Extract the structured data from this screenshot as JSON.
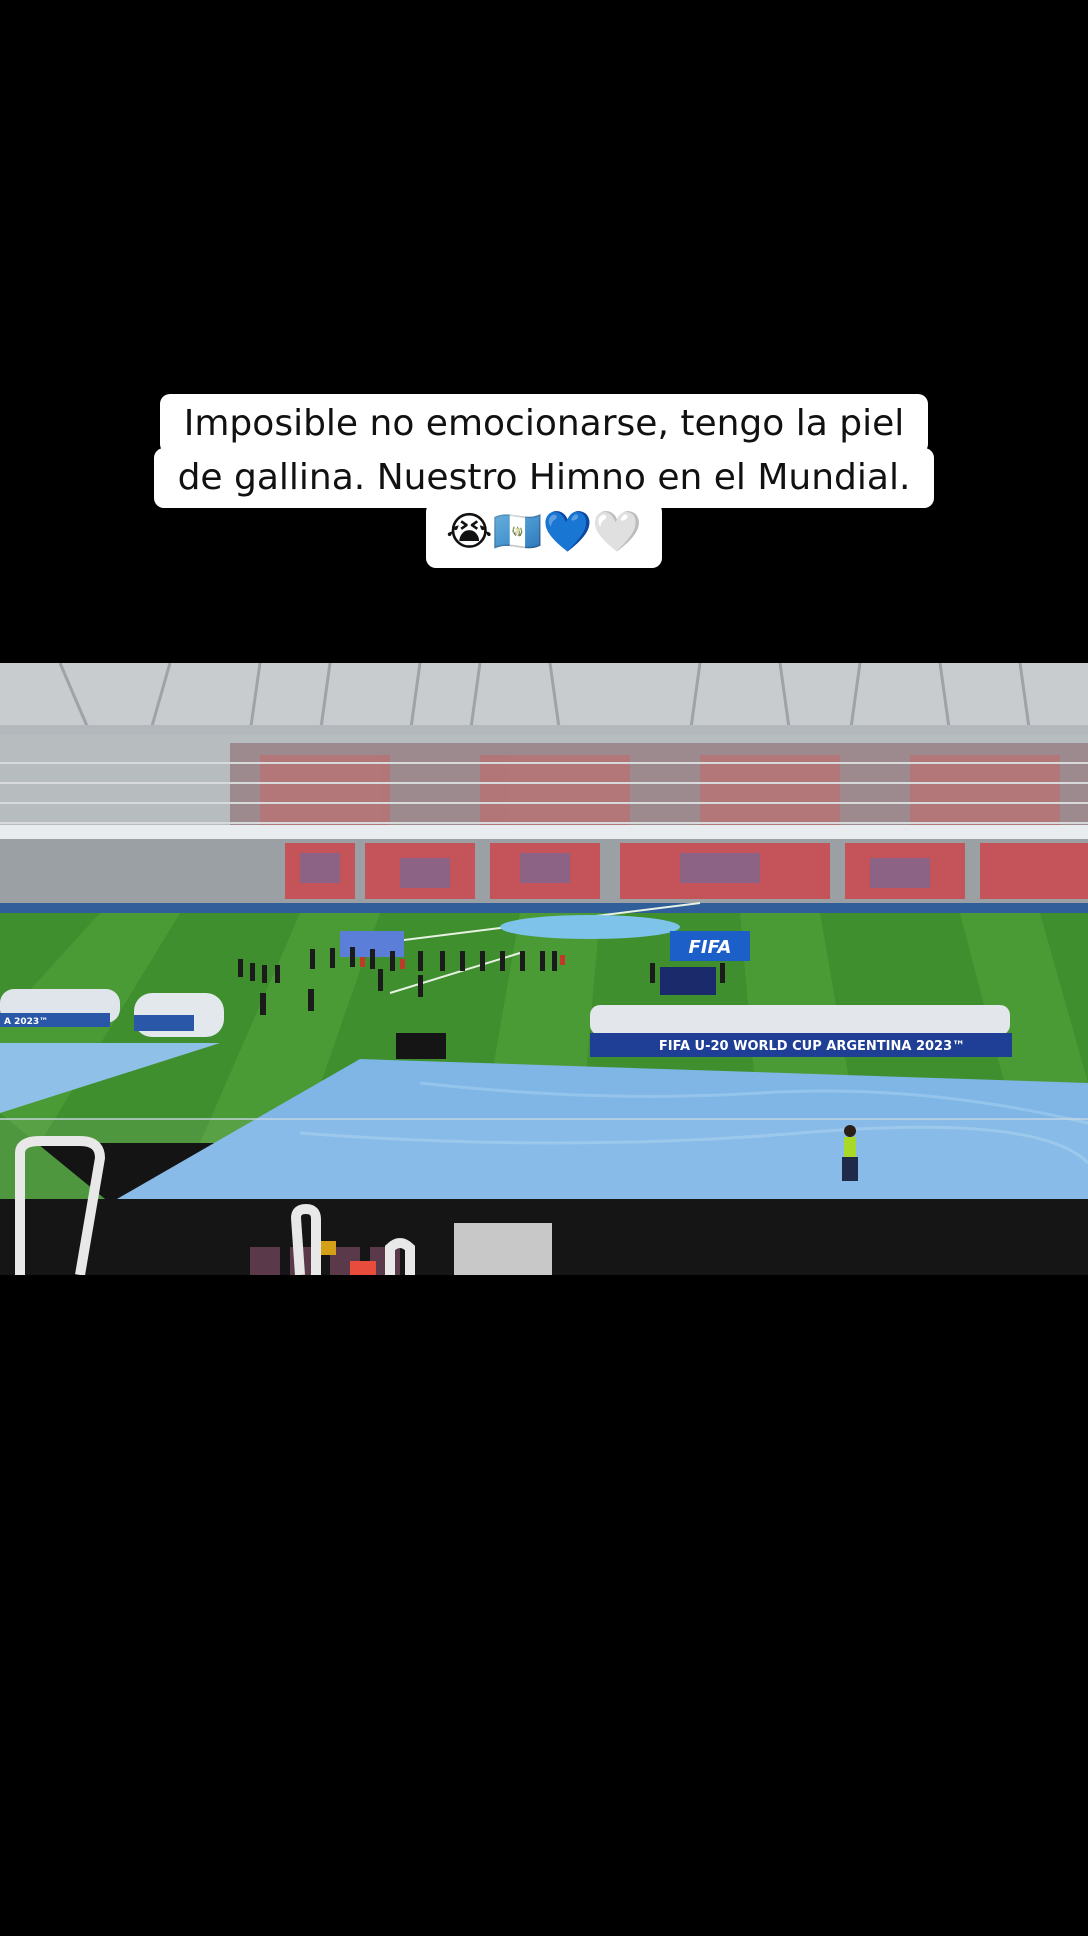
{
  "caption": {
    "line1": "Imposible no emocionarse, tengo la piel",
    "line2": "de gallina. Nuestro Himno en el Mundial.",
    "emojis": "😭🇬🇹💙🤍"
  },
  "stadium": {
    "fifa_banner": "FIFA",
    "bench_banner": "FIFA U-20 WORLD CUP ARGENTINA 2023™",
    "bench_banner_left": "A 2023™"
  },
  "colors": {
    "background": "#000000",
    "caption_bg": "#ffffff",
    "pitch": "#3f8f2e",
    "track": "#7fb6e6",
    "fifa_blue": "#1d5fc8"
  }
}
